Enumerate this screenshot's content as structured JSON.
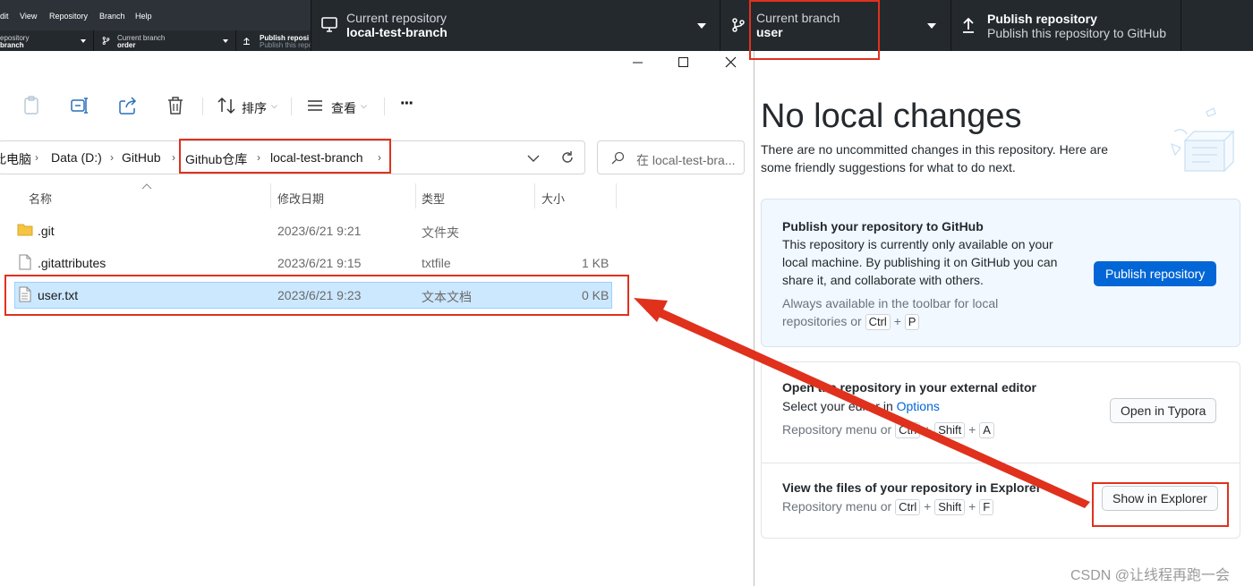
{
  "background_app": {
    "menu": [
      "dit",
      "View",
      "Repository",
      "Branch",
      "Help"
    ],
    "repo_label": "epository",
    "repo_value": "branch",
    "branch_label": "Current branch",
    "branch_value": "order",
    "publish_label": "Publish reposi",
    "publish_sub": "Publish this repo"
  },
  "toolbar": {
    "current_repository_label": "Current repository",
    "current_repository_value": "local-test-branch",
    "current_branch_label": "Current branch",
    "current_branch_value": "user",
    "publish_title": "Publish repository",
    "publish_subtitle": "Publish this repository to GitHub"
  },
  "main": {
    "title": "No local changes",
    "description": "There are no uncommitted changes in this repository. Here are some friendly suggestions for what to do next.",
    "publish_card": {
      "title": "Publish your repository to GitHub",
      "text": "This repository is currently only available on your local machine. By publishing it on GitHub you can share it, and collaborate with others.",
      "hint_prefix": "Always available in the toolbar for local",
      "hint_line2": "repositories or",
      "key1": "Ctrl",
      "plus": "+",
      "key2": "P",
      "button": "Publish repository"
    },
    "editor_card": {
      "title": "Open the repository in your external editor",
      "text_prefix": "Select your editor in",
      "link": "Options",
      "hint_prefix": "Repository menu or",
      "key1": "Ctrl",
      "key2": "Shift",
      "key3": "A",
      "button": "Open in Typora"
    },
    "explorer_card": {
      "title": "View the files of your repository in Explorer",
      "hint_prefix": "Repository menu or",
      "key1": "Ctrl",
      "key2": "Shift",
      "key3": "F",
      "button": "Show in Explorer"
    }
  },
  "explorer": {
    "sort_label": "排序",
    "view_label": "查看",
    "more": "···",
    "breadcrumb": [
      "此电脑",
      "Data (D:)",
      "GitHub",
      "Github仓库",
      "local-test-branch"
    ],
    "search_placeholder": "在 local-test-bra...",
    "columns": [
      "名称",
      "修改日期",
      "类型",
      "大小"
    ],
    "files": [
      {
        "name": ".git",
        "date": "2023/6/21 9:21",
        "type": "文件夹",
        "size": "",
        "icon": "folder-icon"
      },
      {
        "name": ".gitattributes",
        "date": "2023/6/21 9:15",
        "type": "txtfile",
        "size": "1 KB",
        "icon": "file-icon"
      },
      {
        "name": "user.txt",
        "date": "2023/6/21 9:23",
        "type": "文本文档",
        "size": "0 KB",
        "icon": "text-file-icon"
      }
    ]
  },
  "watermark": "CSDN @让线程再跑一会",
  "colors": {
    "toolbar_bg": "#24292e",
    "accent_blue": "#0366d6",
    "annotation_red": "#e0311d",
    "selection_bg": "#cce8ff"
  }
}
